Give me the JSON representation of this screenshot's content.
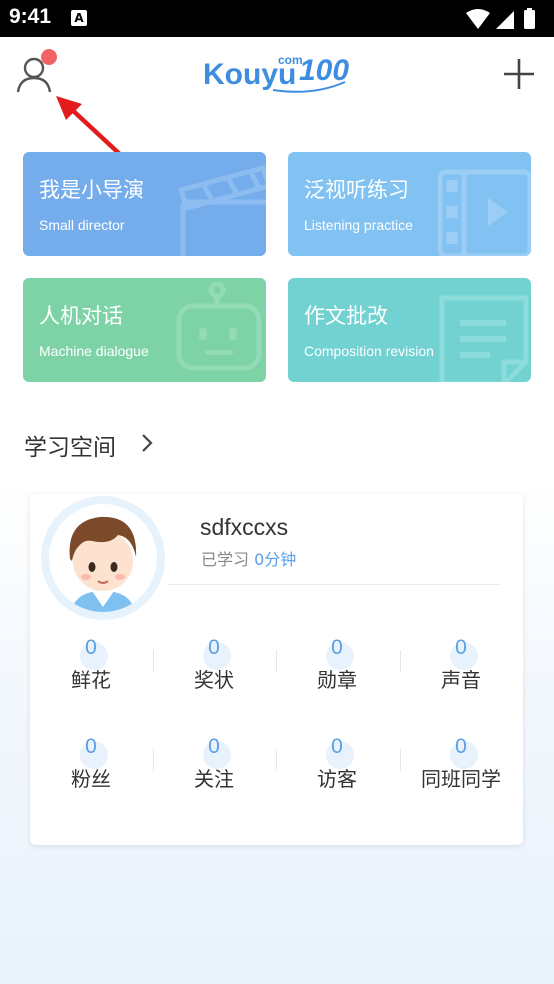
{
  "status_bar": {
    "time": "9:41",
    "notification_icon": "A"
  },
  "header": {
    "logo_text": "Kouyu",
    "logo_com": "com",
    "logo_num": "100",
    "profile_icon": "user-icon",
    "add_icon": "plus-icon"
  },
  "features": [
    {
      "title": "我是小导演",
      "subtitle": "Small director",
      "icon": "clapperboard-icon",
      "color": "#74acec"
    },
    {
      "title": "泛视听练习",
      "subtitle": "Listening practice",
      "icon": "film-play-icon",
      "color": "#81c2f2"
    },
    {
      "title": "人机对话",
      "subtitle": "Machine dialogue",
      "icon": "robot-icon",
      "color": "#7dd3a6"
    },
    {
      "title": "作文批改",
      "subtitle": "Composition revision",
      "icon": "document-icon",
      "color": "#72d2d2"
    }
  ],
  "study_space": {
    "title": "学习空间"
  },
  "profile": {
    "username": "sdfxccxs",
    "studied_label": "已学习",
    "studied_value": "0分钟",
    "stats": [
      {
        "value": "0",
        "label": "鲜花"
      },
      {
        "value": "0",
        "label": "奖状"
      },
      {
        "value": "0",
        "label": "勋章"
      },
      {
        "value": "0",
        "label": "声音"
      },
      {
        "value": "0",
        "label": "粉丝"
      },
      {
        "value": "0",
        "label": "关注"
      },
      {
        "value": "0",
        "label": "访客"
      },
      {
        "value": "0",
        "label": "同班同学"
      }
    ]
  }
}
